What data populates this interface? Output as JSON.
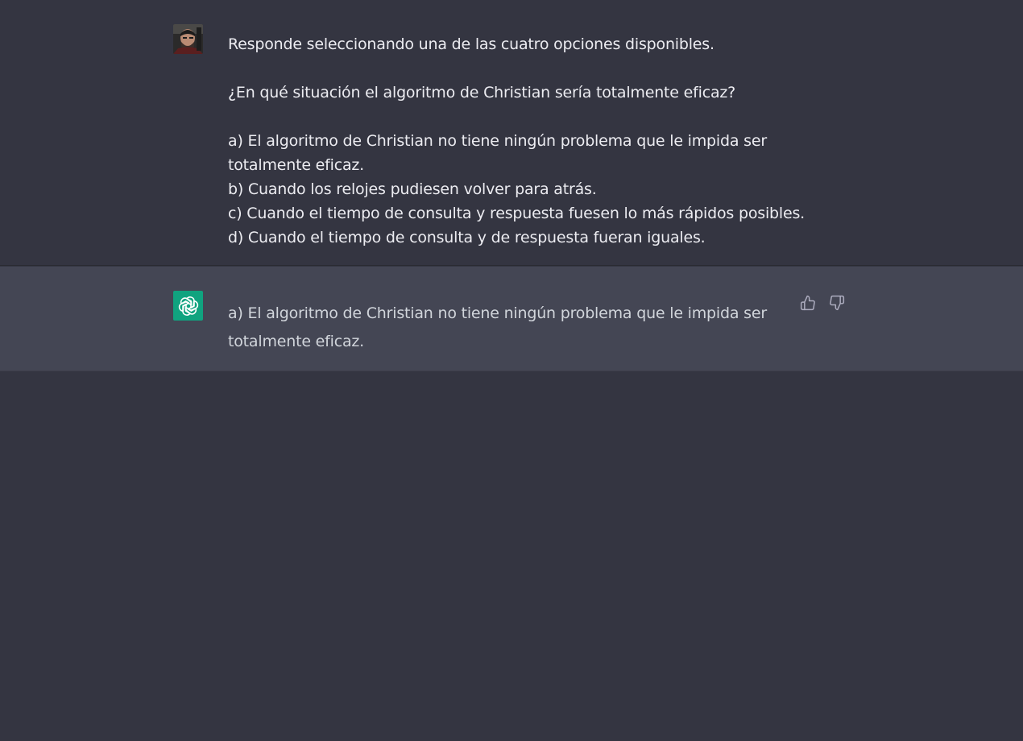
{
  "conversation": {
    "user_message": {
      "line_1": "Responde seleccionando una de las cuatro opciones disponibles.",
      "line_2": "¿En qué situación el algoritmo de Christian sería totalmente eficaz?",
      "option_a_1": "a) El algoritmo de Christian no tiene ningún problema que le impida ser",
      "option_a_2": "totalmente eficaz.",
      "option_b": "b) Cuando los relojes pudiesen volver para atrás.",
      "option_c": "c) Cuando el tiempo de consulta y respuesta fuesen lo más rápidos posibles.",
      "option_d": "d) Cuando el tiempo de consulta y de respuesta fueran iguales."
    },
    "assistant_message": {
      "line_1": "a) El algoritmo de Christian no tiene ningún problema que le impida ser",
      "line_2": "totalmente eficaz."
    }
  },
  "icons": {
    "user_avatar": "user-avatar-photo",
    "assistant_avatar": "openai-logo-icon",
    "thumbs_up": "thumbs-up-icon",
    "thumbs_down": "thumbs-down-icon"
  },
  "colors": {
    "background": "#343541",
    "assistant_background": "#444654",
    "assistant_avatar": "#10a37f",
    "user_text": "#ececf1",
    "assistant_text": "#d1d5db"
  }
}
